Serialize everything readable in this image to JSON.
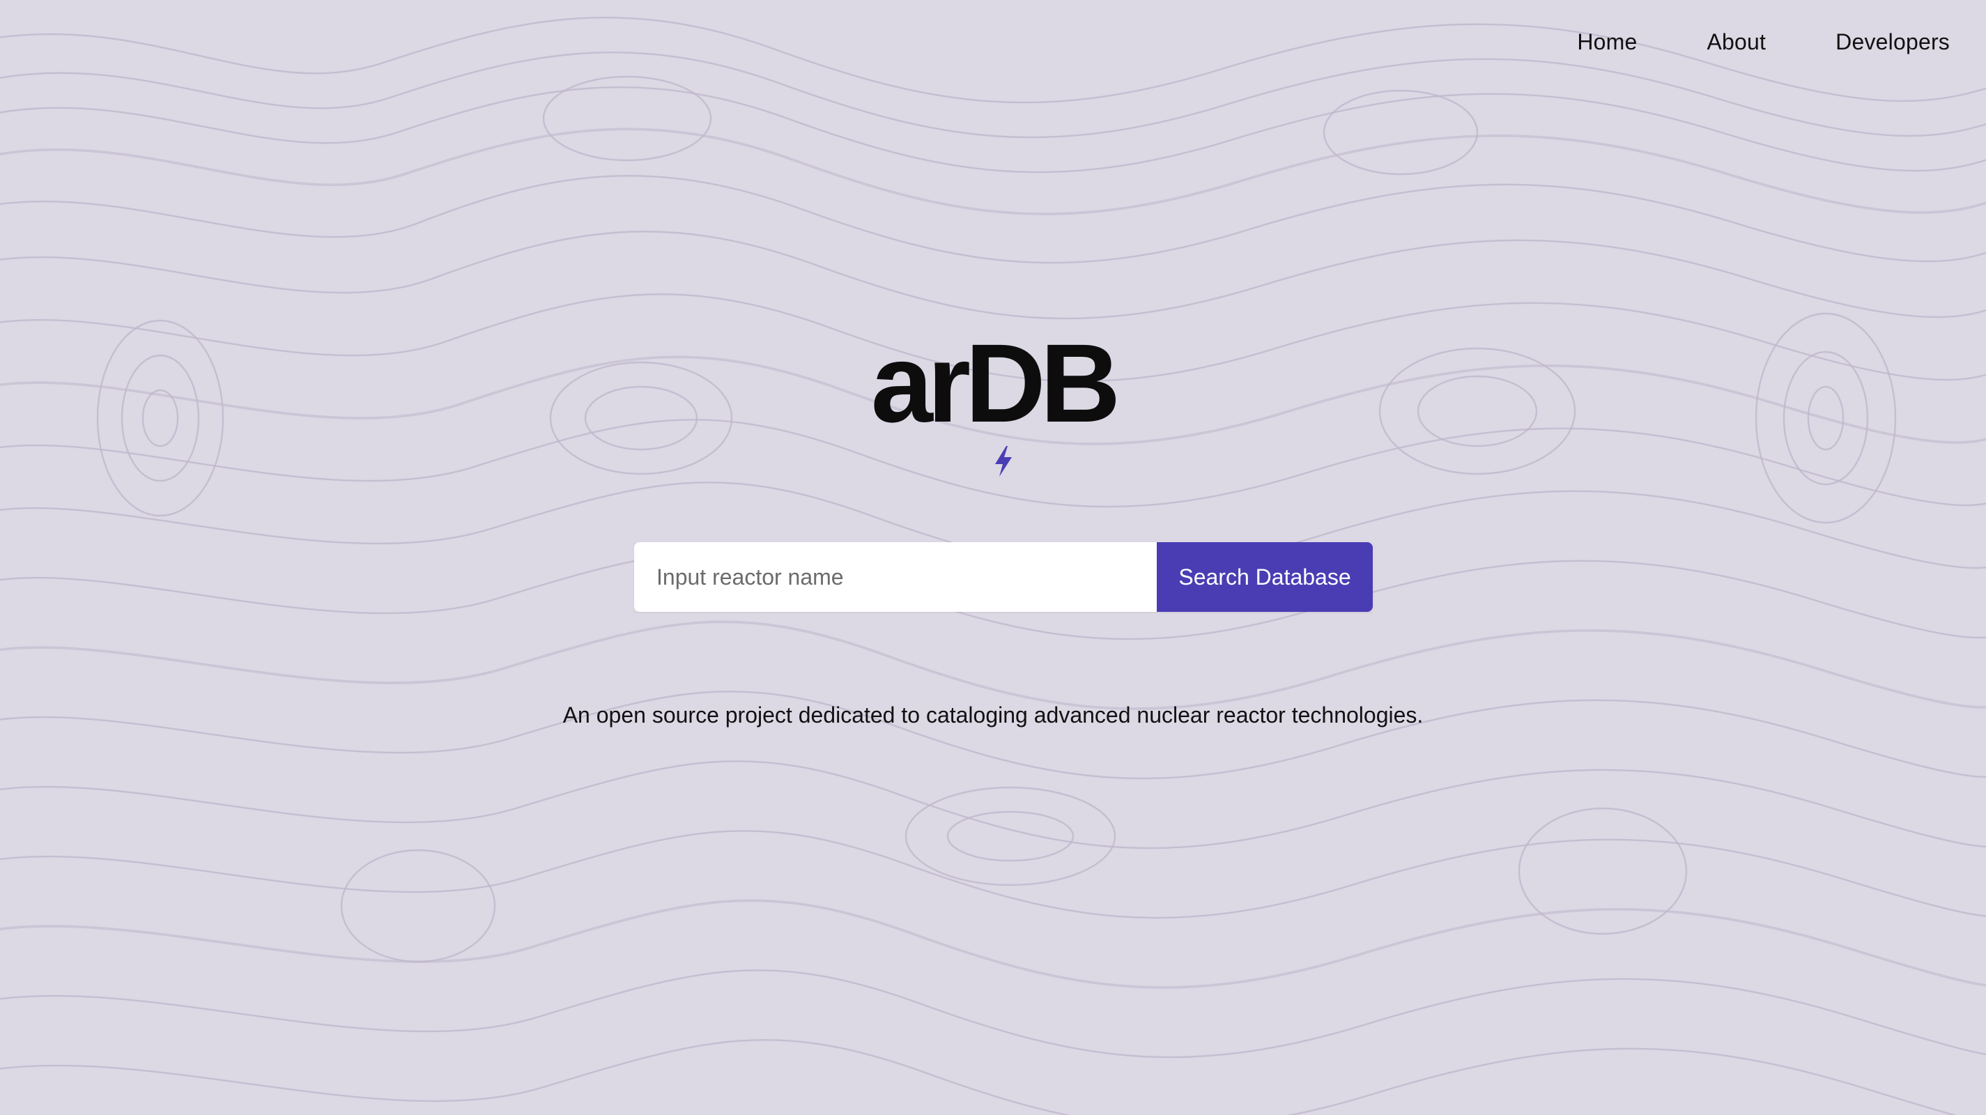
{
  "nav": {
    "items": [
      {
        "label": "Home"
      },
      {
        "label": "About"
      },
      {
        "label": "Developers"
      }
    ]
  },
  "hero": {
    "logo_text": "arDB",
    "logo_icon": "lightning-bolt-icon",
    "search": {
      "placeholder": "Input reactor name",
      "value": "",
      "button_label": "Search Database"
    },
    "tagline": "An open source project dedicated to cataloging advanced nuclear reactor technologies."
  },
  "colors": {
    "background": "#dcd8e4",
    "contour_lines": "#bdb6cb",
    "accent": "#4a3db4",
    "text": "#111111"
  }
}
